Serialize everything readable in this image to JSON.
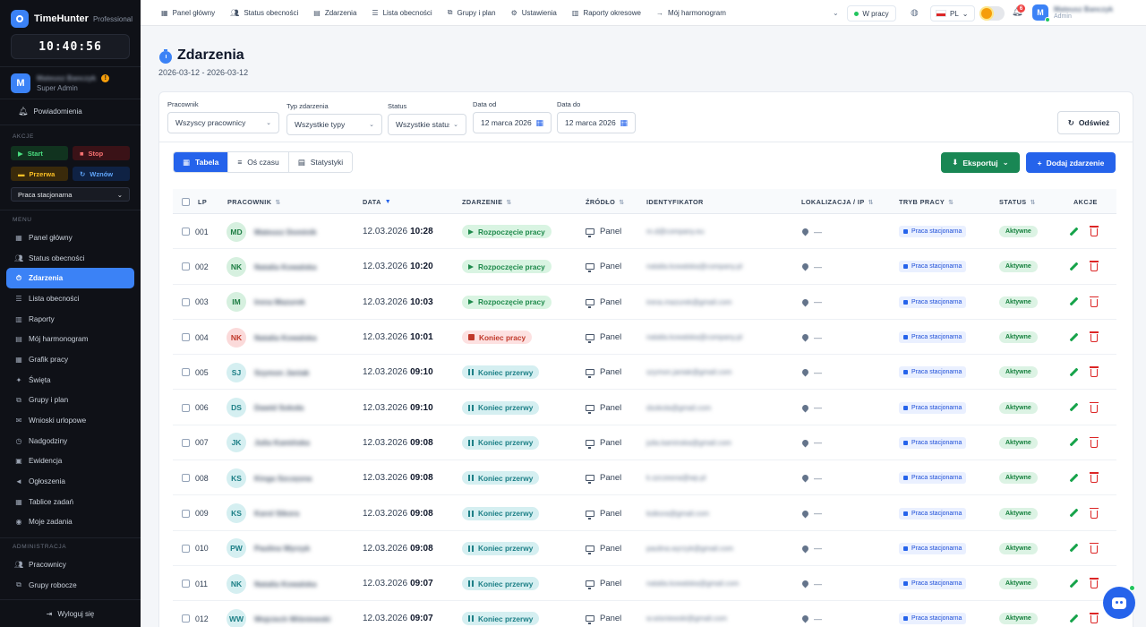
{
  "sidebar": {
    "brand": "TimeHunter",
    "plan": "Professional",
    "clock": "10:40:56",
    "user": {
      "initial": "M",
      "name": "Mateusz Banczyk",
      "role": "Super Admin",
      "warning": "!"
    },
    "notifications_label": "Powiadomienia",
    "actions_section": "AKCJE",
    "actions": {
      "start": "Start",
      "stop": "Stop",
      "break": "Przerwa",
      "resume": "Wznów"
    },
    "work_mode": "Praca stacjonarna",
    "menu_section": "MENU",
    "menu": [
      {
        "label": "Panel główny",
        "icon": "grid-icon"
      },
      {
        "label": "Status obecności",
        "icon": "users-icon"
      },
      {
        "label": "Zdarzenia",
        "icon": "stopwatch-icon"
      },
      {
        "label": "Lista obecności",
        "icon": "list-icon"
      },
      {
        "label": "Raporty",
        "icon": "chart-icon"
      },
      {
        "label": "Mój harmonogram",
        "icon": "calendar-icon"
      },
      {
        "label": "Grafik pracy",
        "icon": "schedule-icon"
      },
      {
        "label": "Święta",
        "icon": "star-icon"
      },
      {
        "label": "Grupy i plan",
        "icon": "group-icon"
      },
      {
        "label": "Wnioski urlopowe",
        "icon": "leave-icon"
      },
      {
        "label": "Nadgodziny",
        "icon": "clock-icon"
      },
      {
        "label": "Ewidencja",
        "icon": "register-icon"
      },
      {
        "label": "Ogłoszenia",
        "icon": "megaphone-icon"
      },
      {
        "label": "Tablice zadań",
        "icon": "board-icon"
      },
      {
        "label": "Moje zadania",
        "icon": "task-icon"
      }
    ],
    "admin_section": "ADMINISTRACJA",
    "admin_menu": [
      {
        "label": "Pracownicy",
        "icon": "users-icon"
      },
      {
        "label": "Grupy robocze",
        "icon": "group-icon"
      }
    ],
    "logout": "Wyloguj się"
  },
  "topbar": {
    "nav": [
      {
        "label": "Panel główny",
        "icon": "grid-icon"
      },
      {
        "label": "Status obecności",
        "icon": "users-icon"
      },
      {
        "label": "Zdarzenia",
        "icon": "document-icon"
      },
      {
        "label": "Lista obecności",
        "icon": "list-icon"
      },
      {
        "label": "Grupy i plan",
        "icon": "group-icon"
      },
      {
        "label": "Ustawienia",
        "icon": "gear-icon"
      },
      {
        "label": "Raporty okresowe",
        "icon": "chart-icon"
      },
      {
        "label": "Mój harmonogram",
        "icon": "arrow-right-icon"
      }
    ],
    "status": "W pracy",
    "lang": "PL",
    "notifications_count": "6",
    "user": {
      "initial": "M",
      "name": "Mateusz Banczyk",
      "role": "Admin"
    }
  },
  "page": {
    "title": "Zdarzenia",
    "date_range": "2026-03-12 - 2026-03-12"
  },
  "filters": {
    "employee": {
      "label": "Pracownik",
      "value": "Wszyscy pracownicy"
    },
    "type": {
      "label": "Typ zdarzenia",
      "value": "Wszystkie typy"
    },
    "status": {
      "label": "Status",
      "value": "Wszystkie statusy"
    },
    "date_from": {
      "label": "Data od",
      "value": "12 marca 2026"
    },
    "date_to": {
      "label": "Data do",
      "value": "12 marca 2026"
    },
    "refresh": "Odśwież"
  },
  "views": {
    "table": "Tabela",
    "timeline": "Oś czasu",
    "stats": "Statystyki"
  },
  "export": "Eksportuj",
  "add": "Dodaj zdarzenie",
  "table": {
    "headers": {
      "lp": "LP",
      "employee": "PRACOWNIK",
      "date": "DATA",
      "event": "ZDARZENIE",
      "source": "ŹRÓDŁO",
      "identifier": "IDENTYFIKATOR",
      "location": "LOKALIZACJA / IP",
      "mode": "TRYB PRACY",
      "status": "STATUS",
      "actions": "AKCJE"
    },
    "rows": [
      {
        "lp": "001",
        "initials": "MD",
        "avatar": "green",
        "name": "Mateusz Dominik",
        "date": "12.03.2026",
        "time": "10:28",
        "event": "Rozpoczęcie pracy",
        "event_kind": "start",
        "source": "Panel",
        "identifier": "m.d@company.eu",
        "location": "—",
        "mode": "Praca stacjonarna",
        "status": "Aktywne"
      },
      {
        "lp": "002",
        "initials": "NK",
        "avatar": "green",
        "name": "Natalia Kowalska",
        "date": "12.03.2026",
        "time": "10:20",
        "event": "Rozpoczęcie pracy",
        "event_kind": "start",
        "source": "Panel",
        "identifier": "natalia.kowalska@company.pl",
        "location": "—",
        "mode": "Praca stacjonarna",
        "status": "Aktywne"
      },
      {
        "lp": "003",
        "initials": "IM",
        "avatar": "green",
        "name": "Irena Mazurek",
        "date": "12.03.2026",
        "time": "10:03",
        "event": "Rozpoczęcie pracy",
        "event_kind": "start",
        "source": "Panel",
        "identifier": "irena.mazurek@gmail.com",
        "location": "—",
        "mode": "Praca stacjonarna",
        "status": "Aktywne"
      },
      {
        "lp": "004",
        "initials": "NK",
        "avatar": "red",
        "name": "Natalia Kowalska",
        "date": "12.03.2026",
        "time": "10:01",
        "event": "Koniec pracy",
        "event_kind": "end",
        "source": "Panel",
        "identifier": "natalia.kowalska@company.pl",
        "location": "—",
        "mode": "Praca stacjonarna",
        "status": "Aktywne"
      },
      {
        "lp": "005",
        "initials": "SJ",
        "avatar": "teal",
        "name": "Szymon Janiak",
        "date": "12.03.2026",
        "time": "09:10",
        "event": "Koniec przerwy",
        "event_kind": "pause",
        "source": "Panel",
        "identifier": "szymon.janiak@gmail.com",
        "location": "—",
        "mode": "Praca stacjonarna",
        "status": "Aktywne"
      },
      {
        "lp": "006",
        "initials": "DS",
        "avatar": "teal",
        "name": "Dawid Sokoła",
        "date": "12.03.2026",
        "time": "09:10",
        "event": "Koniec przerwy",
        "event_kind": "pause",
        "source": "Panel",
        "identifier": "dsokola@gmail.com",
        "location": "—",
        "mode": "Praca stacjonarna",
        "status": "Aktywne"
      },
      {
        "lp": "007",
        "initials": "JK",
        "avatar": "teal",
        "name": "Julia Kamińska",
        "date": "12.03.2026",
        "time": "09:08",
        "event": "Koniec przerwy",
        "event_kind": "pause",
        "source": "Panel",
        "identifier": "julia.kaminska@gmail.com",
        "location": "—",
        "mode": "Praca stacjonarna",
        "status": "Aktywne"
      },
      {
        "lp": "008",
        "initials": "KS",
        "avatar": "teal",
        "name": "Kinga Szczęsna",
        "date": "12.03.2026",
        "time": "09:08",
        "event": "Koniec przerwy",
        "event_kind": "pause",
        "source": "Panel",
        "identifier": "k.szczesna@wp.pl",
        "location": "—",
        "mode": "Praca stacjonarna",
        "status": "Aktywne"
      },
      {
        "lp": "009",
        "initials": "KS",
        "avatar": "teal",
        "name": "Karol Sikora",
        "date": "12.03.2026",
        "time": "09:08",
        "event": "Koniec przerwy",
        "event_kind": "pause",
        "source": "Panel",
        "identifier": "ksikora@gmail.com",
        "location": "—",
        "mode": "Praca stacjonarna",
        "status": "Aktywne"
      },
      {
        "lp": "010",
        "initials": "PW",
        "avatar": "teal",
        "name": "Paulina Wyrzyk",
        "date": "12.03.2026",
        "time": "09:08",
        "event": "Koniec przerwy",
        "event_kind": "pause",
        "source": "Panel",
        "identifier": "paulina.wyrzyk@gmail.com",
        "location": "—",
        "mode": "Praca stacjonarna",
        "status": "Aktywne"
      },
      {
        "lp": "011",
        "initials": "NK",
        "avatar": "teal",
        "name": "Natalia Kowalska",
        "date": "12.03.2026",
        "time": "09:07",
        "event": "Koniec przerwy",
        "event_kind": "pause",
        "source": "Panel",
        "identifier": "natalia.kowalska@gmail.com",
        "location": "—",
        "mode": "Praca stacjonarna",
        "status": "Aktywne"
      },
      {
        "lp": "012",
        "initials": "WW",
        "avatar": "teal",
        "name": "Wojciech Wiśniewski",
        "date": "12.03.2026",
        "time": "09:07",
        "event": "Koniec przerwy",
        "event_kind": "pause",
        "source": "Panel",
        "identifier": "w.wisniewski@gmail.com",
        "location": "—",
        "mode": "Praca stacjonarna",
        "status": "Aktywne"
      }
    ]
  }
}
